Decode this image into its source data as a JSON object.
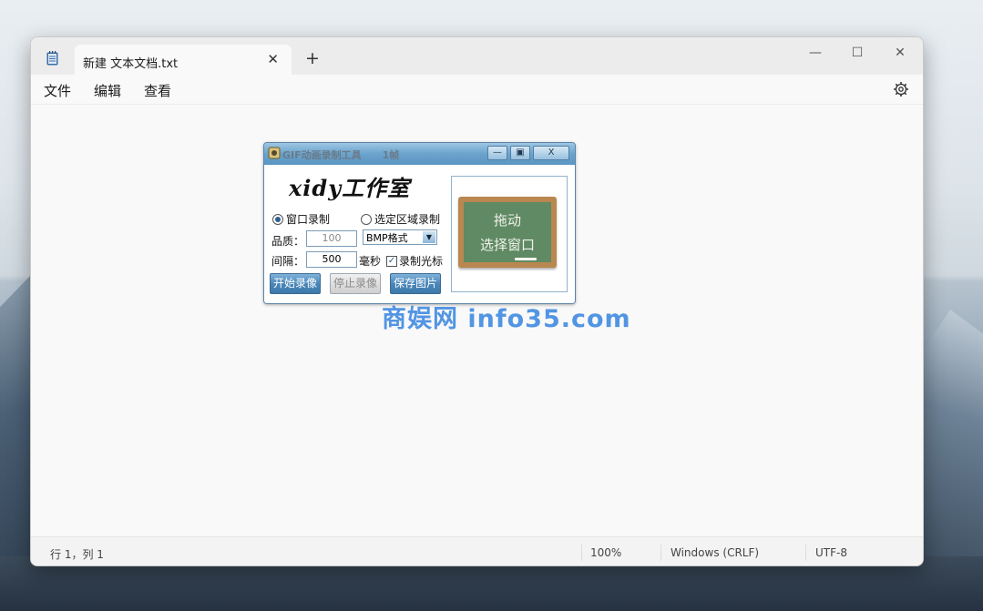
{
  "notepad": {
    "tab_title": "新建 文本文档.txt",
    "tab_close": "✕",
    "new_tab": "+",
    "window_controls": {
      "minimize": "—",
      "maximize": "☐",
      "close": "✕"
    },
    "menu": [
      "文件",
      "编辑",
      "查看"
    ],
    "status": {
      "position": "行 1，列 1",
      "zoom": "100%",
      "line_ending": "Windows (CRLF)",
      "encoding": "UTF-8"
    }
  },
  "gif_tool": {
    "title": "GIF动画录制工具      1帧",
    "controls": {
      "minimize": "—",
      "maximize": "▣",
      "close": "X"
    },
    "brand": "xidy工作室",
    "modes": [
      {
        "label": "窗口录制",
        "selected": true
      },
      {
        "label": "选定区域录制",
        "selected": false
      }
    ],
    "quality_label": "品质：",
    "quality_value": "100",
    "format_value": "BMP格式",
    "interval_label": "间隔：",
    "interval_value": "500",
    "interval_unit": "毫秒",
    "record_cursor_label": "录制光标",
    "record_cursor_checked": true,
    "buttons": {
      "start": "开始录像",
      "stop": "停止录像",
      "save": "保存图片"
    },
    "board_line1": "拖动",
    "board_line2": "选择窗口"
  },
  "watermark": "商娱网 info35.com",
  "colors": {
    "accent": "#4a90e2",
    "button_blue": "#4b87b9",
    "board_green": "#5f8a63"
  }
}
